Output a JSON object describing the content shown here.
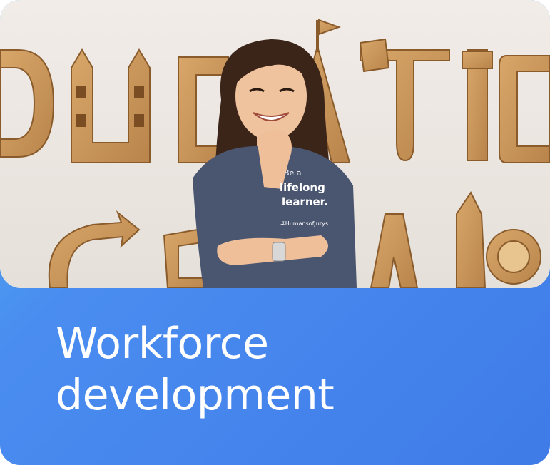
{
  "card": {
    "title_line_1": "Workforce",
    "title_line_2": "development"
  },
  "photo": {
    "shirt_text_1": "Be a",
    "shirt_text_2": "lifelong",
    "shirt_text_3": "learner.",
    "shirt_hashtag": "#HumansofJurys"
  },
  "colors": {
    "gradient_start": "#4eb4ec",
    "gradient_end": "#3f7be8",
    "wall": "#ece7e3",
    "wood": "#c9955a",
    "shirt": "#4a5570"
  }
}
